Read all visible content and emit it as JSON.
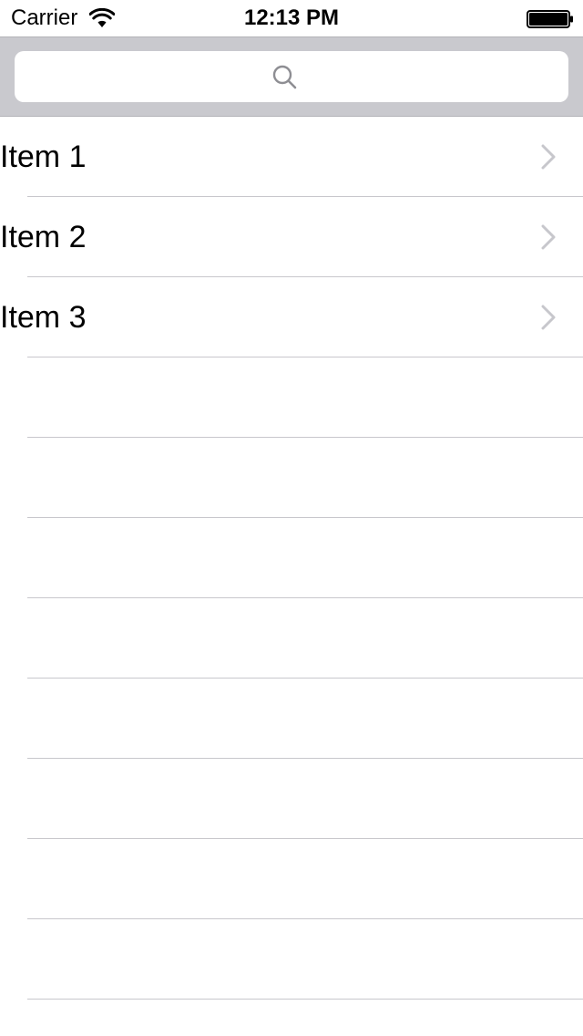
{
  "status_bar": {
    "carrier": "Carrier",
    "time": "12:13 PM",
    "wifi_icon": "wifi-icon",
    "battery_icon": "battery-icon"
  },
  "search": {
    "placeholder": "",
    "value": "",
    "icon": "search-icon"
  },
  "table": {
    "items": [
      {
        "label": "Item 1",
        "accessory": "chevron-right-icon"
      },
      {
        "label": "Item 2",
        "accessory": "chevron-right-icon"
      },
      {
        "label": "Item 3",
        "accessory": "chevron-right-icon"
      }
    ]
  },
  "colors": {
    "search_bar_background": "#c9c9ce",
    "separator": "#c8c7cc",
    "chevron": "#c7c7cc",
    "search_icon": "#8e8e93"
  }
}
